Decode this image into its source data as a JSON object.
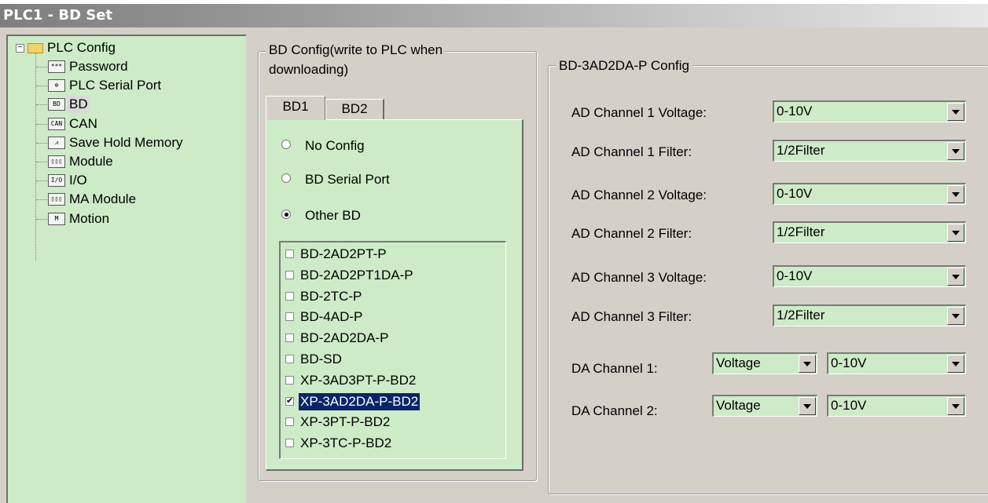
{
  "window": {
    "title": "PLC1 - BD Set"
  },
  "tree": {
    "root_label": "PLC Config",
    "items": [
      {
        "label": "Password",
        "icon": "password-icon",
        "glyph": "*** "
      },
      {
        "label": "PLC Serial Port",
        "icon": "serial-port-icon",
        "glyph": "⊕"
      },
      {
        "label": "BD",
        "icon": "bd-icon",
        "glyph": "BD"
      },
      {
        "label": "CAN",
        "icon": "can-icon",
        "glyph": "CAN"
      },
      {
        "label": "Save Hold Memory",
        "icon": "memory-icon",
        "glyph": "⩘"
      },
      {
        "label": "Module",
        "icon": "module-icon",
        "glyph": "▯▯▯"
      },
      {
        "label": "I/O",
        "icon": "io-icon",
        "glyph": "I/O"
      },
      {
        "label": "MA Module",
        "icon": "ma-module-icon",
        "glyph": "▯▯▯"
      },
      {
        "label": "Motion",
        "icon": "motion-icon",
        "glyph": "M"
      }
    ]
  },
  "bd_config": {
    "title_line1": "BD Config(write to PLC when",
    "title_line2": "downloading)",
    "tabs": [
      "BD1",
      "BD2"
    ],
    "radios": [
      {
        "label": "No Config",
        "selected": false
      },
      {
        "label": "BD Serial Port",
        "selected": false
      },
      {
        "label": "Other BD",
        "selected": true
      }
    ],
    "list": [
      {
        "label": "BD-2AD2PT-P",
        "checked": false
      },
      {
        "label": "BD-2AD2PT1DA-P",
        "checked": false
      },
      {
        "label": "BD-2TC-P",
        "checked": false
      },
      {
        "label": "BD-4AD-P",
        "checked": false
      },
      {
        "label": "BD-2AD2DA-P",
        "checked": false
      },
      {
        "label": "BD-SD",
        "checked": false
      },
      {
        "label": "XP-3AD3PT-P-BD2",
        "checked": false
      },
      {
        "label": "XP-3AD2DA-P-BD2",
        "checked": true
      },
      {
        "label": "XP-3PT-P-BD2",
        "checked": false
      },
      {
        "label": "XP-3TC-P-BD2",
        "checked": false
      }
    ]
  },
  "device_config": {
    "title": "BD-3AD2DA-P Config",
    "rows": [
      {
        "label": "AD Channel 1 Voltage:",
        "value": "0-10V"
      },
      {
        "label": "AD Channel 1 Filter:",
        "value": "1/2Filter"
      },
      {
        "label": "AD Channel 2 Voltage:",
        "value": "0-10V"
      },
      {
        "label": "AD Channel 2 Filter:",
        "value": "1/2Filter"
      },
      {
        "label": "AD Channel 3 Voltage:",
        "value": "0-10V"
      },
      {
        "label": "AD Channel 3 Filter:",
        "value": "1/2Filter"
      }
    ],
    "da_rows": [
      {
        "label": "DA Channel 1:",
        "mode": "Voltage",
        "range": "0-10V"
      },
      {
        "label": "DA Channel 2:",
        "mode": "Voltage",
        "range": "0-10V"
      }
    ]
  },
  "colors": {
    "panel_green": "#cdebc7",
    "window_gray": "#d4d0c8",
    "selection": "#0a246a"
  }
}
